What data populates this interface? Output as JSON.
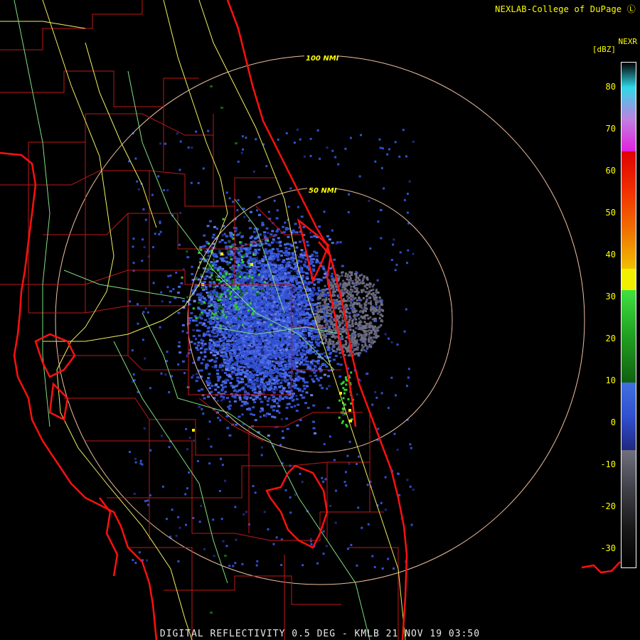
{
  "header": {
    "credit": "NEXLAB-College of DuPage"
  },
  "footer": {
    "product_line": "DIGITAL REFLECTIVITY 0.5 DEG - KMLB 21 NOV 19 03:50"
  },
  "scale": {
    "product": "NEXR",
    "units": "[dBZ]",
    "ticks": [
      "80",
      "70",
      "60",
      "50",
      "40",
      "30",
      "20",
      "10",
      "0",
      "-10",
      "-20",
      "-30"
    ],
    "colors": {
      "cyan": "#30d8e8",
      "violet": "#c080e0",
      "magenta": "#e020e0",
      "red": "#e00000",
      "orange": "#f07000",
      "yellow": "#f0f000",
      "green": "#30d030",
      "dark_green": "#106010",
      "blue": "#3050d0",
      "navy": "#202880",
      "gray": "#707080",
      "dark_gray": "#202020"
    }
  },
  "rings": {
    "inner_label": "50 NMI",
    "outer_label": "100 NMI"
  },
  "map_colors": {
    "coast": "#ff1010",
    "county": "#c01818",
    "road": "#f0f060",
    "road_alt": "#80e080",
    "ring": "#f0c0a0"
  }
}
